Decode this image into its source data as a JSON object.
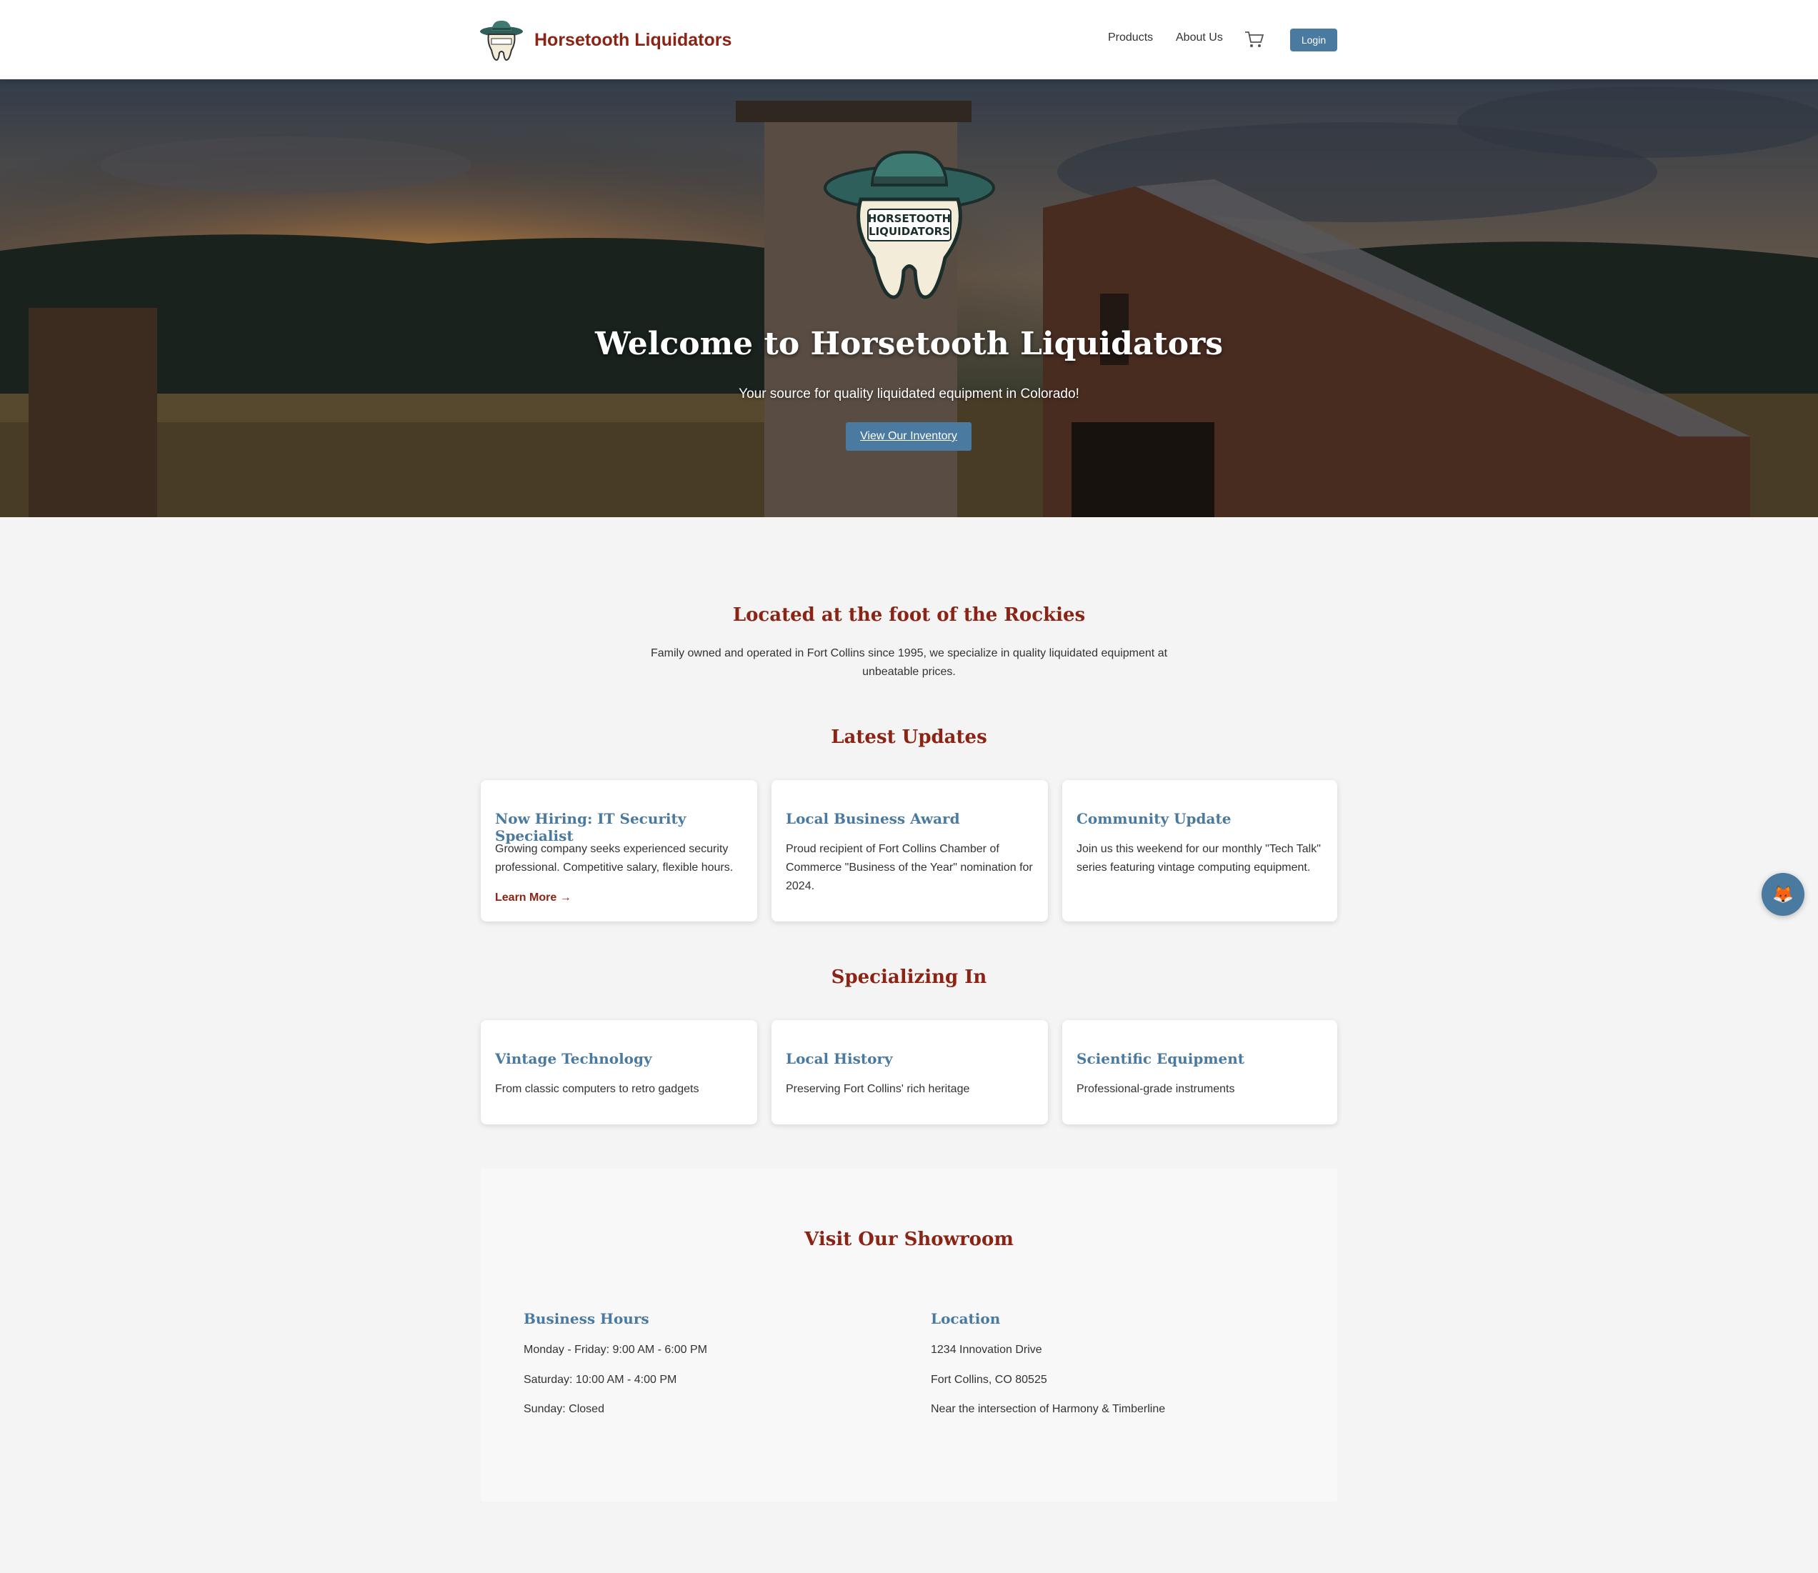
{
  "header": {
    "brand_name": "Horsetooth Liquidators",
    "nav": {
      "products": "Products",
      "about": "About Us"
    },
    "cart_icon": "cart-icon",
    "login_label": "Login"
  },
  "hero": {
    "logo_text_line1": "HORSETOOTH",
    "logo_text_line2": "LIQUIDATORS",
    "title": "Welcome to Horsetooth Liquidators",
    "subtitle": "Your source for quality liquidated equipment in Colorado!",
    "cta_label": "View Our Inventory"
  },
  "intro": {
    "title": "Located at the foot of the Rockies",
    "text": "Family owned and operated in Fort Collins since 1995, we specialize in quality liquidated equipment at unbeatable prices."
  },
  "updates": {
    "title": "Latest Updates",
    "cards": [
      {
        "title": "Now Hiring: IT Security Specialist",
        "text": "Growing company seeks experienced security professional. Competitive salary, flexible hours.",
        "link": "Learn More →"
      },
      {
        "title": "Local Business Award",
        "text": "Proud recipient of Fort Collins Chamber of Commerce \"Business of the Year\" nomination for 2024."
      },
      {
        "title": "Community Update",
        "text": "Join us this weekend for our monthly \"Tech Talk\" series featuring vintage computing equipment."
      }
    ]
  },
  "specializing": {
    "title": "Specializing In",
    "cards": [
      {
        "title": "Vintage Technology",
        "text": "From classic computers to retro gadgets"
      },
      {
        "title": "Local History",
        "text": "Preserving Fort Collins' rich heritage"
      },
      {
        "title": "Scientific Equipment",
        "text": "Professional-grade instruments"
      }
    ]
  },
  "showroom": {
    "title": "Visit Our Showroom",
    "hours": {
      "title": "Business Hours",
      "lines": [
        "Monday - Friday: 9:00 AM - 6:00 PM",
        "Saturday: 10:00 AM - 4:00 PM",
        "Sunday: Closed"
      ]
    },
    "location": {
      "title": "Location",
      "lines": [
        "1234 Innovation Drive",
        "Fort Collins, CO 80525",
        "Near the intersection of Harmony & Timberline"
      ]
    }
  },
  "chat_widget": {
    "icon": "fox-icon",
    "glyph": "🦊"
  },
  "colors": {
    "brand": "#8b2415",
    "accent": "#4a7aa0",
    "background": "#f4f4f4"
  }
}
